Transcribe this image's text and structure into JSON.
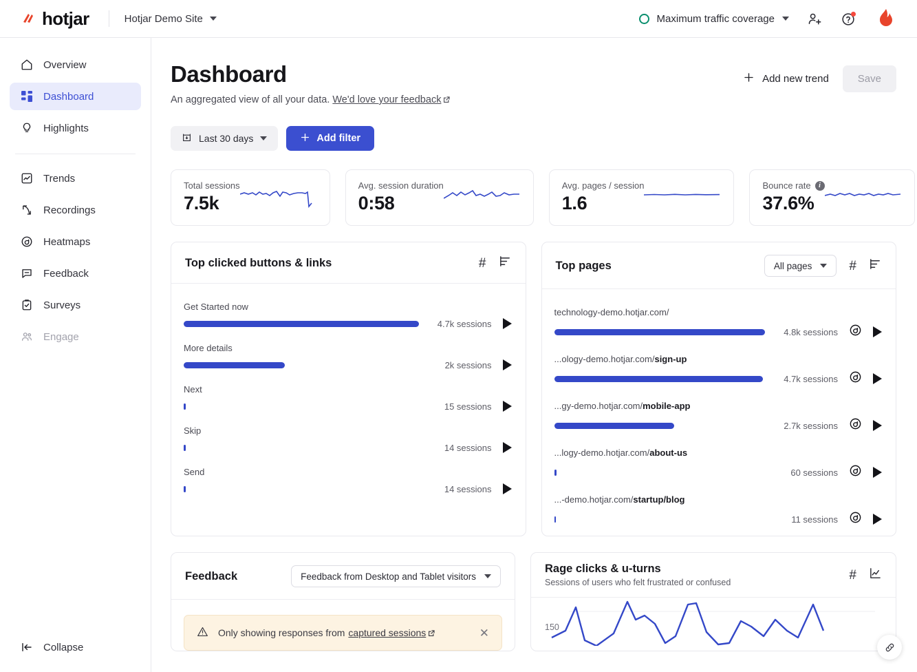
{
  "topbar": {
    "logo_text": "hotjar",
    "site_name": "Hotjar Demo Site",
    "coverage_label": "Maximum traffic coverage",
    "icons": [
      "add-user-icon",
      "help-icon",
      "account-avatar"
    ]
  },
  "sidebar": {
    "items": [
      {
        "label": "Overview",
        "icon": "home-icon",
        "active": false,
        "disabled": false
      },
      {
        "label": "Dashboard",
        "icon": "dashboard-grid-icon",
        "active": true,
        "disabled": false
      },
      {
        "label": "Highlights",
        "icon": "lightbulb-icon",
        "active": false,
        "disabled": false
      },
      {
        "label": "Trends",
        "icon": "trends-chart-icon",
        "active": false,
        "disabled": false
      },
      {
        "label": "Recordings",
        "icon": "recordings-cursor-icon",
        "active": false,
        "disabled": false
      },
      {
        "label": "Heatmaps",
        "icon": "heatmap-icon",
        "active": false,
        "disabled": false
      },
      {
        "label": "Feedback",
        "icon": "feedback-comment-icon",
        "active": false,
        "disabled": false
      },
      {
        "label": "Surveys",
        "icon": "survey-clipboard-icon",
        "active": false,
        "disabled": false
      },
      {
        "label": "Engage",
        "icon": "engage-people-icon",
        "active": false,
        "disabled": true
      }
    ],
    "collapse_label": "Collapse"
  },
  "page": {
    "title": "Dashboard",
    "subtitle_text": "An aggregated view of all your data.",
    "subtitle_link": "We'd love your feedback",
    "add_trend_label": "Add new trend",
    "save_label": "Save",
    "date_filter": "Last 30 days",
    "add_filter_label": "Add filter"
  },
  "kpis": [
    {
      "label": "Total sessions",
      "value": "7.5k",
      "has_info": false
    },
    {
      "label": "Avg. session duration",
      "value": "0:58",
      "has_info": false
    },
    {
      "label": "Avg. pages / session",
      "value": "1.6",
      "has_info": false
    },
    {
      "label": "Bounce rate",
      "value": "37.6%",
      "has_info": true
    }
  ],
  "top_clicked": {
    "title": "Top clicked buttons & links",
    "rows": [
      {
        "label": "Get Started now",
        "sessions": "4.7k sessions",
        "pct": 100
      },
      {
        "label": "More details",
        "sessions": "2k sessions",
        "pct": 43
      },
      {
        "label": "Next",
        "sessions": "15 sessions",
        "pct": 0.7
      },
      {
        "label": "Skip",
        "sessions": "14 sessions",
        "pct": 0.7
      },
      {
        "label": "Send",
        "sessions": "14 sessions",
        "pct": 0.7
      }
    ]
  },
  "top_pages": {
    "title": "Top pages",
    "filter_label": "All pages",
    "rows": [
      {
        "prefix": "technology-demo.hotjar.com/",
        "path": "",
        "sessions": "4.8k sessions",
        "pct": 100
      },
      {
        "prefix": "...ology-demo.hotjar.com/",
        "path": "sign-up",
        "sessions": "4.7k sessions",
        "pct": 99
      },
      {
        "prefix": "...gy-demo.hotjar.com/",
        "path": "mobile-app",
        "sessions": "2.7k sessions",
        "pct": 57
      },
      {
        "prefix": "...logy-demo.hotjar.com/",
        "path": "about-us",
        "sessions": "60 sessions",
        "pct": 1.3
      },
      {
        "prefix": "...-demo.hotjar.com/",
        "path": "startup/blog",
        "sessions": "11 sessions",
        "pct": 1.0
      }
    ]
  },
  "feedback": {
    "title": "Feedback",
    "select_label": "Feedback from Desktop and Tablet visitors",
    "notice_text": "Only showing responses from",
    "notice_link": "captured sessions"
  },
  "rage": {
    "title": "Rage clicks & u-turns",
    "subtitle": "Sessions of users who felt frustrated or confused",
    "y_tick": "150"
  },
  "colors": {
    "brand_red": "#e8442b",
    "accent_blue": "#3b4fd0",
    "bar_blue": "#3448c8",
    "sidebar_active_bg": "#e9ebfc",
    "sidebar_active_fg": "#3d4fd4",
    "coverage_green": "#0a8f6e",
    "notice_bg": "#fdf3e2"
  },
  "chart_data": {
    "type": "line",
    "title": "Rage clicks & u-turns",
    "subtitle": "Sessions of users who felt frustrated or confused",
    "ylabel": "",
    "xlabel": "",
    "yticks": [
      150
    ],
    "ylim": [
      0,
      190
    ],
    "grid": true,
    "legend": "none",
    "series": [
      {
        "name": "Rage clicks & u-turns",
        "values": [
          35,
          60,
          165,
          20,
          10,
          40,
          185,
          120,
          140,
          95,
          25,
          40,
          175,
          182,
          55,
          15,
          20,
          85,
          70,
          45,
          90,
          60,
          35,
          180,
          70
        ]
      }
    ]
  }
}
